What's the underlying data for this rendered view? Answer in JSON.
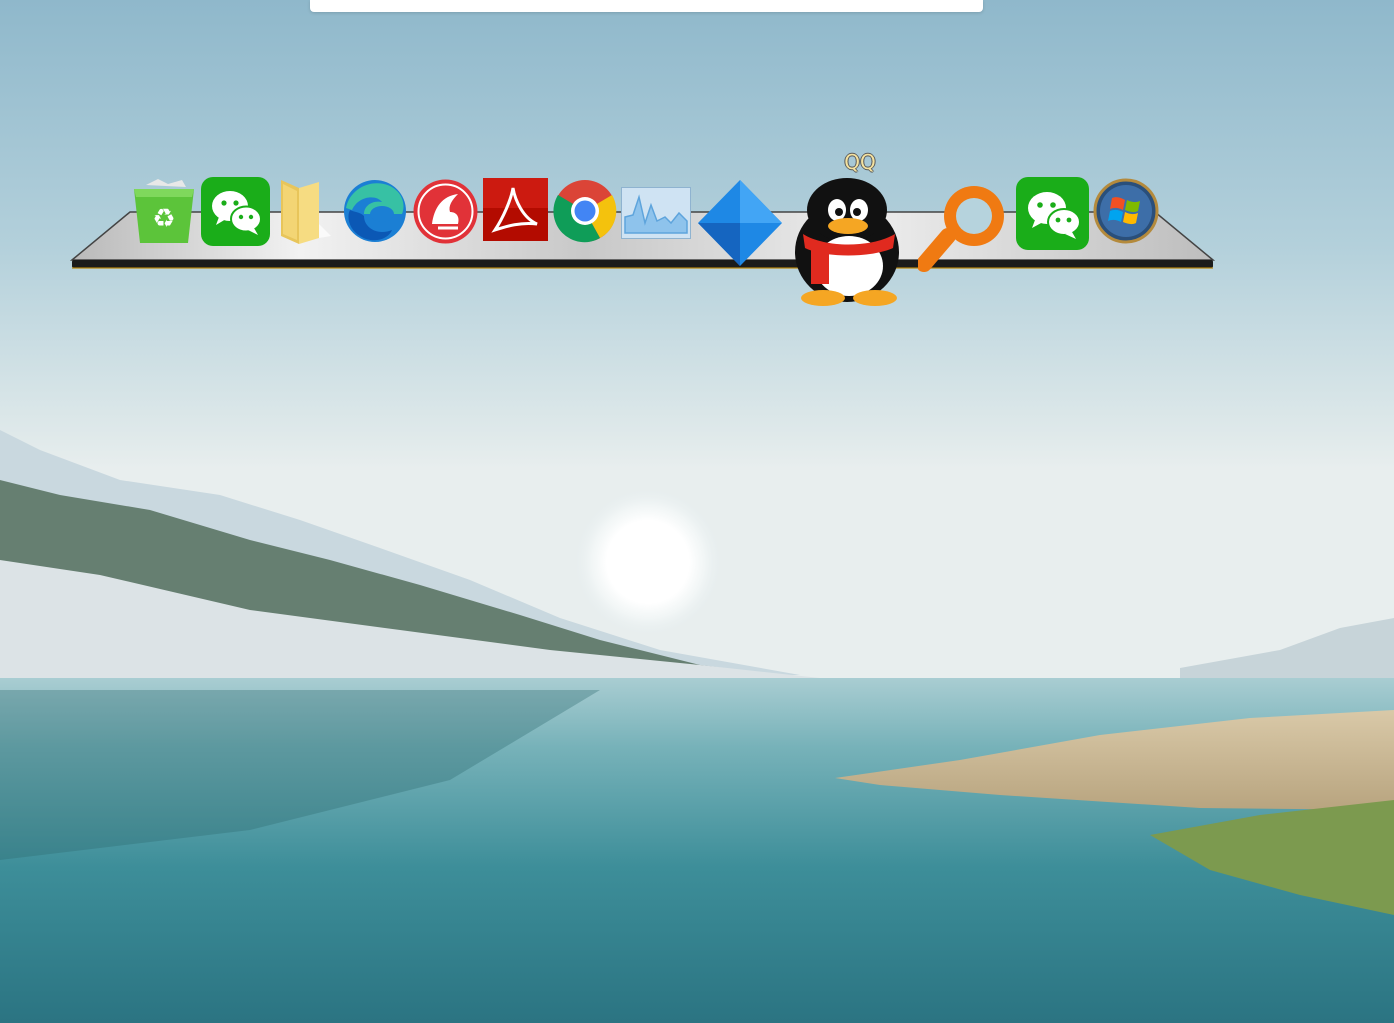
{
  "desktop": {
    "wallpaper": "lake-sunrise-landscape",
    "top_bar_label": ""
  },
  "dock": {
    "hovered_tooltip": "QQ",
    "items": [
      {
        "icon": "recycle-bin-icon"
      },
      {
        "icon": "wechat-icon"
      },
      {
        "icon": "folder-icon"
      },
      {
        "icon": "edge-icon"
      },
      {
        "icon": "delphi-icon"
      },
      {
        "icon": "acrobat-icon"
      },
      {
        "icon": "chrome-icon"
      },
      {
        "icon": "performance-monitor-icon"
      },
      {
        "icon": "blue-diamond-icon"
      },
      {
        "icon": "qq-penguin-icon"
      },
      {
        "icon": "orange-search-icon"
      },
      {
        "icon": "wechat-icon"
      },
      {
        "icon": "windows-start-icon"
      }
    ]
  },
  "colors": {
    "wechat_green": "#1aad19",
    "qq_red": "#e02a1f",
    "search_orange": "#f07a12",
    "diamond_blue": "#1e88e5"
  }
}
